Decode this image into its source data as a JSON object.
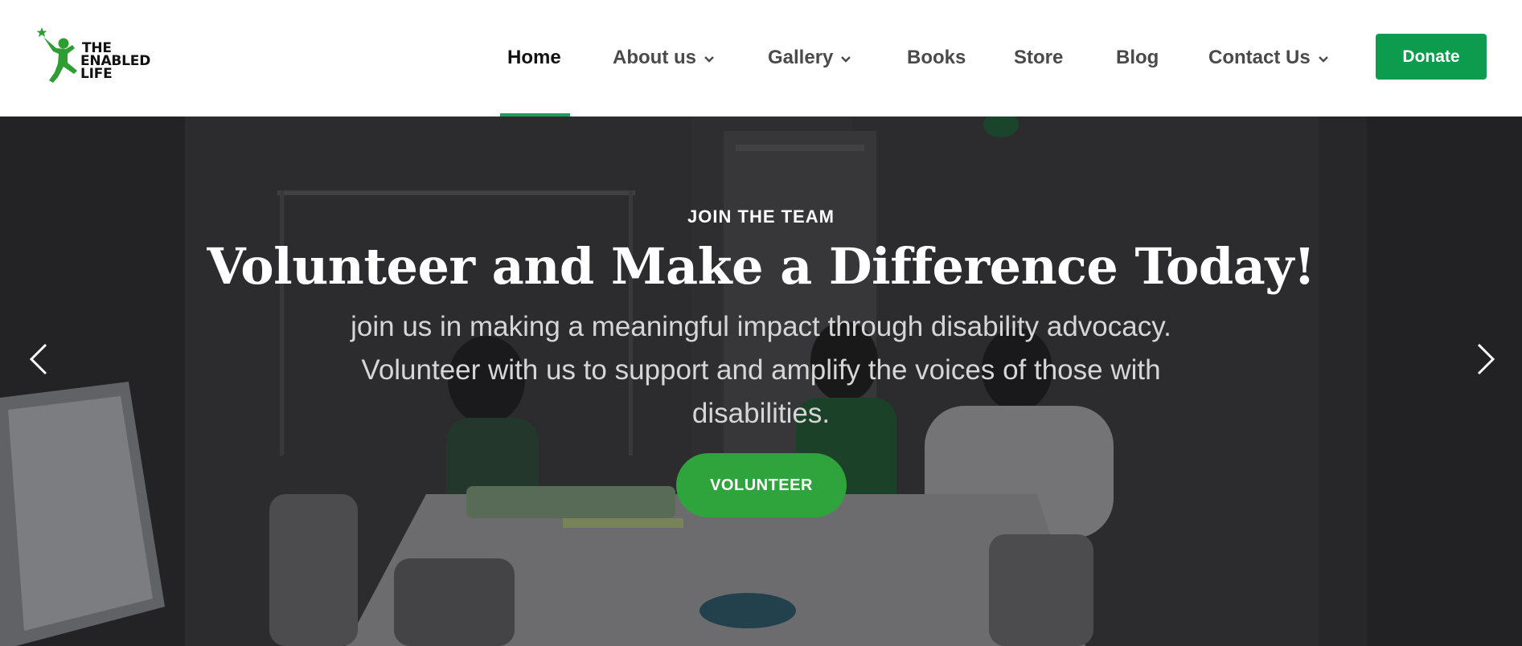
{
  "brand": {
    "logo_line1": "THE",
    "logo_line2": "ENABLED",
    "logo_line3": "LIFE",
    "icon": "running-figure-star-icon",
    "color": "#2e9e32"
  },
  "nav": {
    "items": [
      {
        "label": "Home",
        "active": true,
        "dropdown": false
      },
      {
        "label": "About us",
        "active": false,
        "dropdown": true
      },
      {
        "label": "Gallery",
        "active": false,
        "dropdown": true
      },
      {
        "label": "Books",
        "active": false,
        "dropdown": false
      },
      {
        "label": "Store",
        "active": false,
        "dropdown": false
      },
      {
        "label": "Blog",
        "active": false,
        "dropdown": false
      },
      {
        "label": "Contact Us",
        "active": false,
        "dropdown": true
      }
    ],
    "donate_label": "Donate",
    "accent": "#0d9b4e"
  },
  "hero": {
    "eyebrow": "JOIN THE TEAM",
    "headline": "Volunteer and Make a Difference Today!",
    "subtext": "join us in making a meaningful impact through disability advocacy. Volunteer with us to support and amplify the voices of those with disabilities.",
    "cta_label": "VOLUNTEER",
    "cta_color": "#2fa43c",
    "prev_icon": "chevron-left-icon",
    "next_icon": "chevron-right-icon"
  }
}
